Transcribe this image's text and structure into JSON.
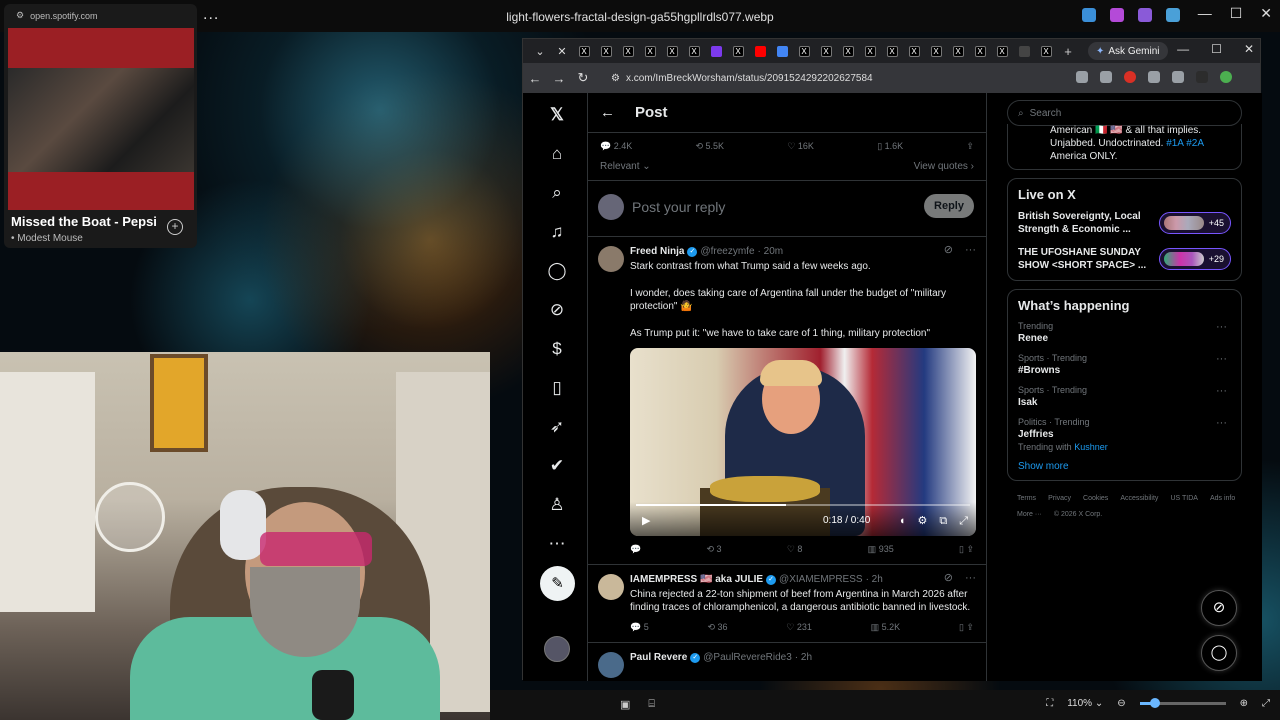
{
  "desktop": {
    "window_title": "light-flowers-fractal-design-ga55hgpllrdls077.webp",
    "menu_dots": "...",
    "controls": [
      "—",
      "☐",
      "✕"
    ]
  },
  "spotify": {
    "url": "open.spotify.com",
    "track": "Missed the Boat - Pepsi",
    "artist": "• Modest Mouse",
    "add_icon": "+"
  },
  "browser": {
    "tab_count_icons": 22,
    "ask_gemini": "Ask Gemini",
    "url": "x.com/ImBreckWorsham/status/2091524292202627584",
    "controls": [
      "—",
      "☐",
      "✕"
    ],
    "zoom": "110%",
    "zoom_level": 0.18
  },
  "x": {
    "header": {
      "title": "Post"
    },
    "post_stats": {
      "replies": "2.4K",
      "reposts": "5.5K",
      "likes": "16K",
      "bookmarks": "1.6K"
    },
    "sort": {
      "label": "Relevant",
      "view_quotes": "View quotes"
    },
    "reply_box": {
      "placeholder": "Post your reply",
      "button": "Reply"
    },
    "tweets": [
      {
        "name": "Freed Ninja",
        "handle": "@freezymfe",
        "time": "· 20m",
        "text1": "Stark contrast from what Trump said a few weeks ago.",
        "text2": "I wonder, does taking care of Argentina fall under the budget of \"military protection\" 🤷",
        "text3": "As Trump put it: \"we have to take care of 1 thing, military protection\"",
        "video_time": "0:18 / 0:40",
        "video_progress": 0.45,
        "replies": "",
        "reposts": "3",
        "likes": "8",
        "views": "935"
      },
      {
        "name": "IAMEMPRESS 🇺🇸 aka JULIE",
        "handle": "@XIAMEMPRESS",
        "time": "· 2h",
        "text1": "China rejected a 22-ton shipment of beef from Argentina in March 2026 after finding traces of chloramphenicol, a dangerous antibiotic banned in livestock.",
        "replies": "5",
        "reposts": "36",
        "likes": "231",
        "views": "5.2K"
      },
      {
        "name": "Paul Revere",
        "handle": "@PaulRevereRide3",
        "time": "· 2h"
      }
    ],
    "search_placeholder": "Search",
    "bio": {
      "line1": "American 🇮🇹 🇺🇸 & all that implies.",
      "line2": "Unjabbed. Undoctrinated. ",
      "tags": "#1A #2A",
      "line3": "America ONLY."
    },
    "live": {
      "title": "Live on X",
      "items": [
        {
          "title": "British Sovereignty, Local Strength & Economic ...",
          "count": "+45"
        },
        {
          "title": "THE UFOSHANE SUNDAY SHOW <SHORT SPACE> ...",
          "count": "+29"
        }
      ]
    },
    "happening": {
      "title": "What’s happening",
      "items": [
        {
          "context": "Trending",
          "title": "Renee",
          "with": "",
          "with_link": ""
        },
        {
          "context": "Sports · Trending",
          "title": "#Browns",
          "with": "",
          "with_link": ""
        },
        {
          "context": "Sports · Trending",
          "title": "Isak",
          "with": "",
          "with_link": ""
        },
        {
          "context": "Politics · Trending",
          "title": "Jeffries",
          "with": "Trending with ",
          "with_link": "Kushner"
        }
      ],
      "show_more": "Show more"
    },
    "footer": [
      "Terms",
      "Privacy",
      "Cookies",
      "Accessibility",
      "US TIDA",
      "Ads info",
      "More ···",
      "© 2026 X Corp."
    ]
  }
}
